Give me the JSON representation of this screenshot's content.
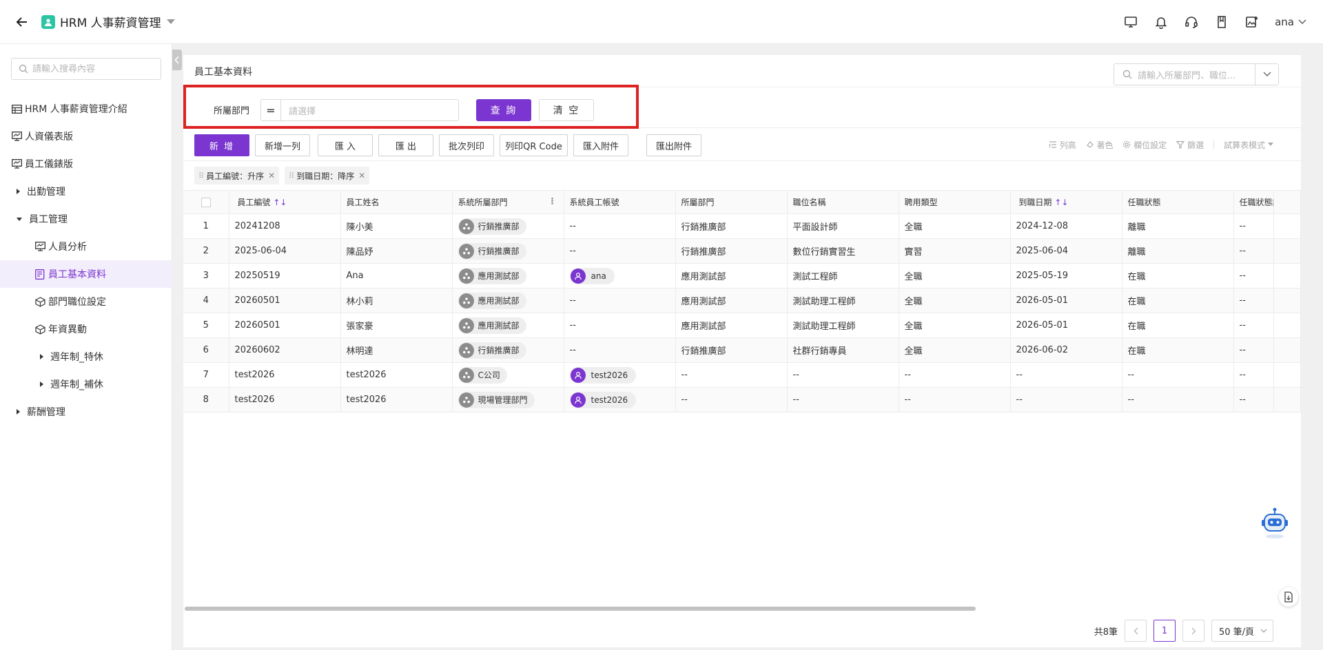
{
  "app": {
    "title": "HRM 人事薪資管理",
    "user": "ana"
  },
  "sidebar": {
    "search_placeholder": "請輸入搜尋內容",
    "items": [
      {
        "label": "HRM 人事薪資管理介紹"
      },
      {
        "label": "人資儀表版"
      },
      {
        "label": "員工儀錶版"
      },
      {
        "label": "出勤管理"
      },
      {
        "label": "員工管理"
      },
      {
        "label": "人員分析"
      },
      {
        "label": "員工基本資料"
      },
      {
        "label": "部門職位設定"
      },
      {
        "label": "年資異動"
      },
      {
        "label": "週年制_特休"
      },
      {
        "label": "週年制_補休"
      },
      {
        "label": "薪酬管理"
      }
    ]
  },
  "page": {
    "title": "員工基本資料",
    "search_placeholder": "請輸入所屬部門、職位..."
  },
  "filter": {
    "label": "所屬部門",
    "operator": "=",
    "placeholder": "請選擇",
    "query_label": "查 詢",
    "clear_label": "清 空"
  },
  "toolbar": {
    "add": "新 增",
    "add_row": "新增一列",
    "import": "匯 入",
    "export": "匯 出",
    "batch_print": "批次列印",
    "print_qr": "列印QR Code",
    "import_attach": "匯入附件",
    "export_attach": "匯出附件",
    "row_height": "列高",
    "coloring": "著色",
    "field_settings": "欄位設定",
    "filter": "篩選",
    "sheet_mode": "試算表模式"
  },
  "sort_tags": [
    {
      "label": "員工編號：升序"
    },
    {
      "label": "到職日期：降序"
    }
  ],
  "table": {
    "headers": [
      "員工編號",
      "員工姓名",
      "系統所屬部門",
      "系統員工帳號",
      "所屬部門",
      "職位名稱",
      "聘用類型",
      "到職日期",
      "任職狀態",
      "任職狀態說明"
    ],
    "rows": [
      {
        "no": "1",
        "id": "20241208",
        "name": "陳小美",
        "sys_dept": "行銷推廣部",
        "account": "--",
        "dept": "行銷推廣部",
        "position": "平面設計師",
        "type": "全職",
        "date": "2024-12-08",
        "status": "離職",
        "note": "--"
      },
      {
        "no": "2",
        "id": "2025-06-04",
        "name": "陳品妤",
        "sys_dept": "行銷推廣部",
        "account": "--",
        "dept": "行銷推廣部",
        "position": "數位行銷實習生",
        "type": "實習",
        "date": "2025-06-04",
        "status": "離職",
        "note": "--"
      },
      {
        "no": "3",
        "id": "20250519",
        "name": "Ana",
        "sys_dept": "應用測試部",
        "account": "ana",
        "dept": "應用測試部",
        "position": "測試工程師",
        "type": "全職",
        "date": "2025-05-19",
        "status": "在職",
        "note": "--"
      },
      {
        "no": "4",
        "id": "20260501",
        "name": "林小莉",
        "sys_dept": "應用測試部",
        "account": "--",
        "dept": "應用測試部",
        "position": "測試助理工程師",
        "type": "全職",
        "date": "2026-05-01",
        "status": "在職",
        "note": "--"
      },
      {
        "no": "5",
        "id": "20260501",
        "name": "張家豪",
        "sys_dept": "應用測試部",
        "account": "--",
        "dept": "應用測試部",
        "position": "測試助理工程師",
        "type": "全職",
        "date": "2026-05-01",
        "status": "在職",
        "note": "--"
      },
      {
        "no": "6",
        "id": "20260602",
        "name": "林明達",
        "sys_dept": "行銷推廣部",
        "account": "--",
        "dept": "行銷推廣部",
        "position": "社群行銷專員",
        "type": "全職",
        "date": "2026-06-02",
        "status": "在職",
        "note": "--"
      },
      {
        "no": "7",
        "id": "test2026",
        "name": "test2026",
        "sys_dept": "C公司",
        "account": "test2026",
        "dept": "--",
        "position": "--",
        "type": "--",
        "date": "--",
        "status": "--",
        "note": "--"
      },
      {
        "no": "8",
        "id": "test2026",
        "name": "test2026",
        "sys_dept": "現場管理部門",
        "account": "test2026",
        "dept": "--",
        "position": "--",
        "type": "--",
        "date": "--",
        "status": "--",
        "note": "--"
      }
    ]
  },
  "pager": {
    "total": "共8筆",
    "current": "1",
    "page_size": "50 筆/頁"
  },
  "colors": {
    "accent": "#7b35d0",
    "highlight": "#dd2222",
    "app_badge": "#2bc5a5"
  }
}
